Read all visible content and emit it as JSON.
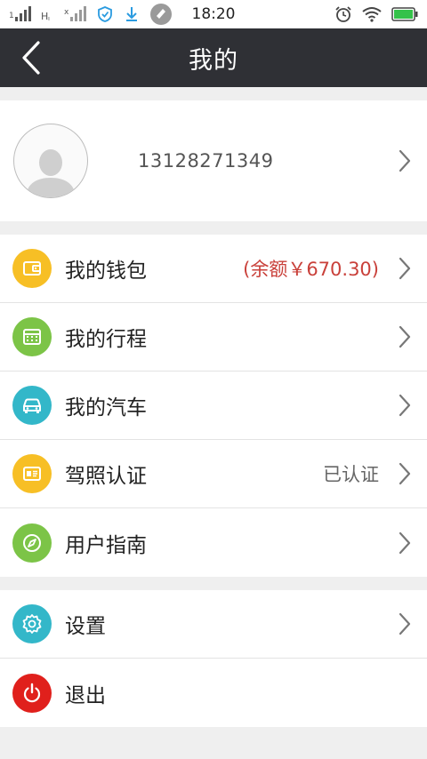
{
  "status_bar": {
    "time": "18:20",
    "signal_label_1": "1",
    "signal_label_2": "H",
    "signal_label_3": "x"
  },
  "header": {
    "title": "我的"
  },
  "profile": {
    "phone": "13128271349"
  },
  "menu": [
    {
      "label": "我的钱包",
      "value": "(余额￥670.30)",
      "icon": "wallet-icon",
      "color": "#f7bf25"
    },
    {
      "label": "我的行程",
      "value": "",
      "icon": "calendar-icon",
      "color": "#7cc447"
    },
    {
      "label": "我的汽车",
      "value": "",
      "icon": "car-icon",
      "color": "#33b7c9"
    },
    {
      "label": "驾照认证",
      "value": "已认证",
      "icon": "license-icon",
      "color": "#f7bf25"
    },
    {
      "label": "用户指南",
      "value": "",
      "icon": "compass-icon",
      "color": "#7cc447"
    }
  ],
  "menu2": [
    {
      "label": "设置",
      "icon": "gear-icon",
      "color": "#33b7c9"
    },
    {
      "label": "退出",
      "icon": "power-icon",
      "color": "#e0201c"
    }
  ]
}
